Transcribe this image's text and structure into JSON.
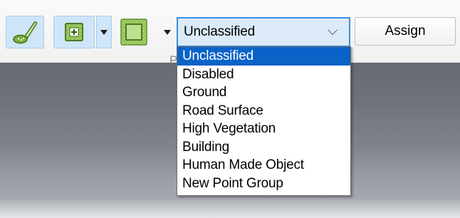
{
  "toolbar": {
    "tools": [
      {
        "icon": "brush-icon",
        "selected": true
      },
      {
        "icon": "add-point-icon",
        "selected": true
      },
      {
        "icon": "rectangle-selection-icon",
        "selected": false
      }
    ],
    "class_select": {
      "value": "Unclassified",
      "options": [
        "Unclassified",
        "Disabled",
        "Ground",
        "Road Surface",
        "High Vegetation",
        "Building",
        "Human Made Object",
        "New Point Group"
      ],
      "highlighted_index": 0
    },
    "assign_label": "Assign",
    "obscured_letter": "P"
  },
  "colors": {
    "selected_bg": "#cfe5f8",
    "selected_border": "#a6cdef",
    "icon_green": "#8bc34a",
    "dropdown_highlight": "#0a63c7",
    "canvas": "#70747d"
  }
}
